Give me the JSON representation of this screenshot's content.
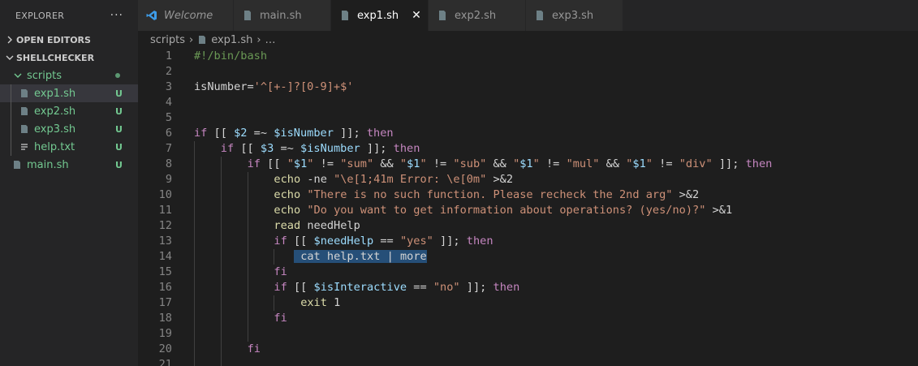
{
  "sidebar": {
    "title": "EXPLORER",
    "more": "···",
    "open_editors": "OPEN EDITORS",
    "project": "SHELLCHECKER",
    "tree": [
      {
        "label": "scripts",
        "badge": "",
        "kind": "folder"
      },
      {
        "label": "exp1.sh",
        "badge": "U",
        "kind": "file"
      },
      {
        "label": "exp2.sh",
        "badge": "U",
        "kind": "file"
      },
      {
        "label": "exp3.sh",
        "badge": "U",
        "kind": "file"
      },
      {
        "label": "help.txt",
        "badge": "U",
        "kind": "text"
      },
      {
        "label": "main.sh",
        "badge": "U",
        "kind": "file"
      }
    ]
  },
  "tabs": [
    {
      "label": "Welcome",
      "icon": "vscode-icon"
    },
    {
      "label": "main.sh",
      "icon": "file-icon"
    },
    {
      "label": "exp1.sh",
      "icon": "file-icon",
      "close": "✕"
    },
    {
      "label": "exp2.sh",
      "icon": "file-icon"
    },
    {
      "label": "exp3.sh",
      "icon": "file-icon"
    }
  ],
  "breadcrumb": {
    "folder": "scripts",
    "file": "exp1.sh",
    "more": "…"
  },
  "colors": {
    "keyword": "#c586c0",
    "builtin": "#dcdcaa",
    "string": "#ce9178",
    "variable": "#9cdcfe",
    "comment": "#6a9955",
    "selection": "#264f78",
    "git_untracked": "#73c991"
  },
  "editor": {
    "lines": [
      {
        "n": "1",
        "indent": 0,
        "tokens": [
          [
            "c",
            "#!/bin/bash"
          ]
        ]
      },
      {
        "n": "2",
        "indent": 0,
        "tokens": []
      },
      {
        "n": "3",
        "indent": 0,
        "tokens": [
          [
            "p",
            "isNumber="
          ],
          [
            "s",
            "'^[+-]?[0-9]+$'"
          ]
        ]
      },
      {
        "n": "4",
        "indent": 0,
        "tokens": []
      },
      {
        "n": "5",
        "indent": 0,
        "tokens": []
      },
      {
        "n": "6",
        "indent": 0,
        "tokens": [
          [
            "k",
            "if"
          ],
          [
            "p",
            " [[ "
          ],
          [
            "v",
            "$2"
          ],
          [
            "p",
            " =~ "
          ],
          [
            "v",
            "$isNumber"
          ],
          [
            "p",
            " ]]; "
          ],
          [
            "k",
            "then"
          ]
        ]
      },
      {
        "n": "7",
        "indent": 1,
        "tokens": [
          [
            "k",
            "if"
          ],
          [
            "p",
            " [[ "
          ],
          [
            "v",
            "$3"
          ],
          [
            "p",
            " =~ "
          ],
          [
            "v",
            "$isNumber"
          ],
          [
            "p",
            " ]]; "
          ],
          [
            "k",
            "then"
          ]
        ]
      },
      {
        "n": "8",
        "indent": 2,
        "tokens": [
          [
            "k",
            "if"
          ],
          [
            "p",
            " [[ "
          ],
          [
            "s",
            "\""
          ],
          [
            "v",
            "$1"
          ],
          [
            "s",
            "\""
          ],
          [
            "p",
            " != "
          ],
          [
            "s",
            "\"sum\""
          ],
          [
            "p",
            " && "
          ],
          [
            "s",
            "\""
          ],
          [
            "v",
            "$1"
          ],
          [
            "s",
            "\""
          ],
          [
            "p",
            " != "
          ],
          [
            "s",
            "\"sub\""
          ],
          [
            "p",
            " && "
          ],
          [
            "s",
            "\""
          ],
          [
            "v",
            "$1"
          ],
          [
            "s",
            "\""
          ],
          [
            "p",
            " != "
          ],
          [
            "s",
            "\"mul\""
          ],
          [
            "p",
            " && "
          ],
          [
            "s",
            "\""
          ],
          [
            "v",
            "$1"
          ],
          [
            "s",
            "\""
          ],
          [
            "p",
            " != "
          ],
          [
            "s",
            "\"div\""
          ],
          [
            "p",
            " ]]; "
          ],
          [
            "k",
            "then"
          ]
        ]
      },
      {
        "n": "9",
        "indent": 3,
        "tokens": [
          [
            "b",
            "echo"
          ],
          [
            "p",
            " -ne "
          ],
          [
            "s",
            "\"\\e[1;41m Error: \\e[0m\""
          ],
          [
            "p",
            " >&2"
          ]
        ]
      },
      {
        "n": "10",
        "indent": 3,
        "tokens": [
          [
            "b",
            "echo"
          ],
          [
            "p",
            " "
          ],
          [
            "s",
            "\"There is no such function. Please recheck the 2nd arg\""
          ],
          [
            "p",
            " >&2"
          ]
        ]
      },
      {
        "n": "11",
        "indent": 3,
        "tokens": [
          [
            "b",
            "echo"
          ],
          [
            "p",
            " "
          ],
          [
            "s",
            "\"Do you want to get information about operations? (yes/no)?\""
          ],
          [
            "p",
            " >&1"
          ]
        ]
      },
      {
        "n": "12",
        "indent": 3,
        "tokens": [
          [
            "b",
            "read"
          ],
          [
            "p",
            " needHelp"
          ]
        ]
      },
      {
        "n": "13",
        "indent": 3,
        "tokens": [
          [
            "k",
            "if"
          ],
          [
            "p",
            " [[ "
          ],
          [
            "v",
            "$needHelp"
          ],
          [
            "p",
            " == "
          ],
          [
            "s",
            "\"yes\""
          ],
          [
            "p",
            " ]]; "
          ],
          [
            "k",
            "then"
          ]
        ]
      },
      {
        "n": "14",
        "indent": 4,
        "selected": true,
        "tokens": [
          [
            "p",
            "cat help.txt | more"
          ]
        ]
      },
      {
        "n": "15",
        "indent": 3,
        "tokens": [
          [
            "k",
            "fi"
          ]
        ]
      },
      {
        "n": "16",
        "indent": 3,
        "tokens": [
          [
            "k",
            "if"
          ],
          [
            "p",
            " [[ "
          ],
          [
            "v",
            "$isInteractive"
          ],
          [
            "p",
            " == "
          ],
          [
            "s",
            "\"no\""
          ],
          [
            "p",
            " ]]; "
          ],
          [
            "k",
            "then"
          ]
        ]
      },
      {
        "n": "17",
        "indent": 4,
        "tokens": [
          [
            "b",
            "exit"
          ],
          [
            "p",
            " 1"
          ]
        ]
      },
      {
        "n": "18",
        "indent": 3,
        "tokens": [
          [
            "k",
            "fi"
          ]
        ]
      },
      {
        "n": "19",
        "indent": 3,
        "tokens": []
      },
      {
        "n": "20",
        "indent": 2,
        "tokens": [
          [
            "k",
            "fi"
          ]
        ]
      },
      {
        "n": "21",
        "indent": 2,
        "tokens": []
      }
    ]
  }
}
